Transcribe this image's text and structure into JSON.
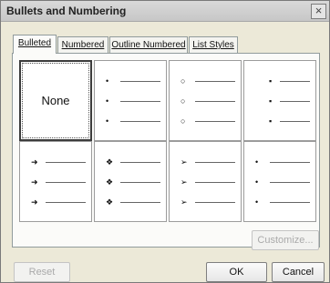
{
  "window": {
    "title": "Bullets and Numbering",
    "close_glyph": "×"
  },
  "tabs": [
    {
      "label": "Bulleted",
      "active": true
    },
    {
      "label": "Numbered",
      "active": false
    },
    {
      "label": "Outline Numbered",
      "active": false
    },
    {
      "label": "List Styles",
      "active": false
    }
  ],
  "gallery": {
    "none_label": "None",
    "styles": [
      {
        "name": "none",
        "glyph": ""
      },
      {
        "name": "dot",
        "glyph": "•"
      },
      {
        "name": "circle",
        "glyph": "○"
      },
      {
        "name": "square",
        "glyph": "▪"
      },
      {
        "name": "picture-arrow",
        "glyph": "➜"
      },
      {
        "name": "four-diamond",
        "glyph": "❖"
      },
      {
        "name": "arrowhead",
        "glyph": "➢"
      },
      {
        "name": "small-dot",
        "glyph": "•"
      }
    ]
  },
  "buttons": {
    "customize": "Customize...",
    "reset": "Reset",
    "ok": "OK",
    "cancel": "Cancel"
  }
}
